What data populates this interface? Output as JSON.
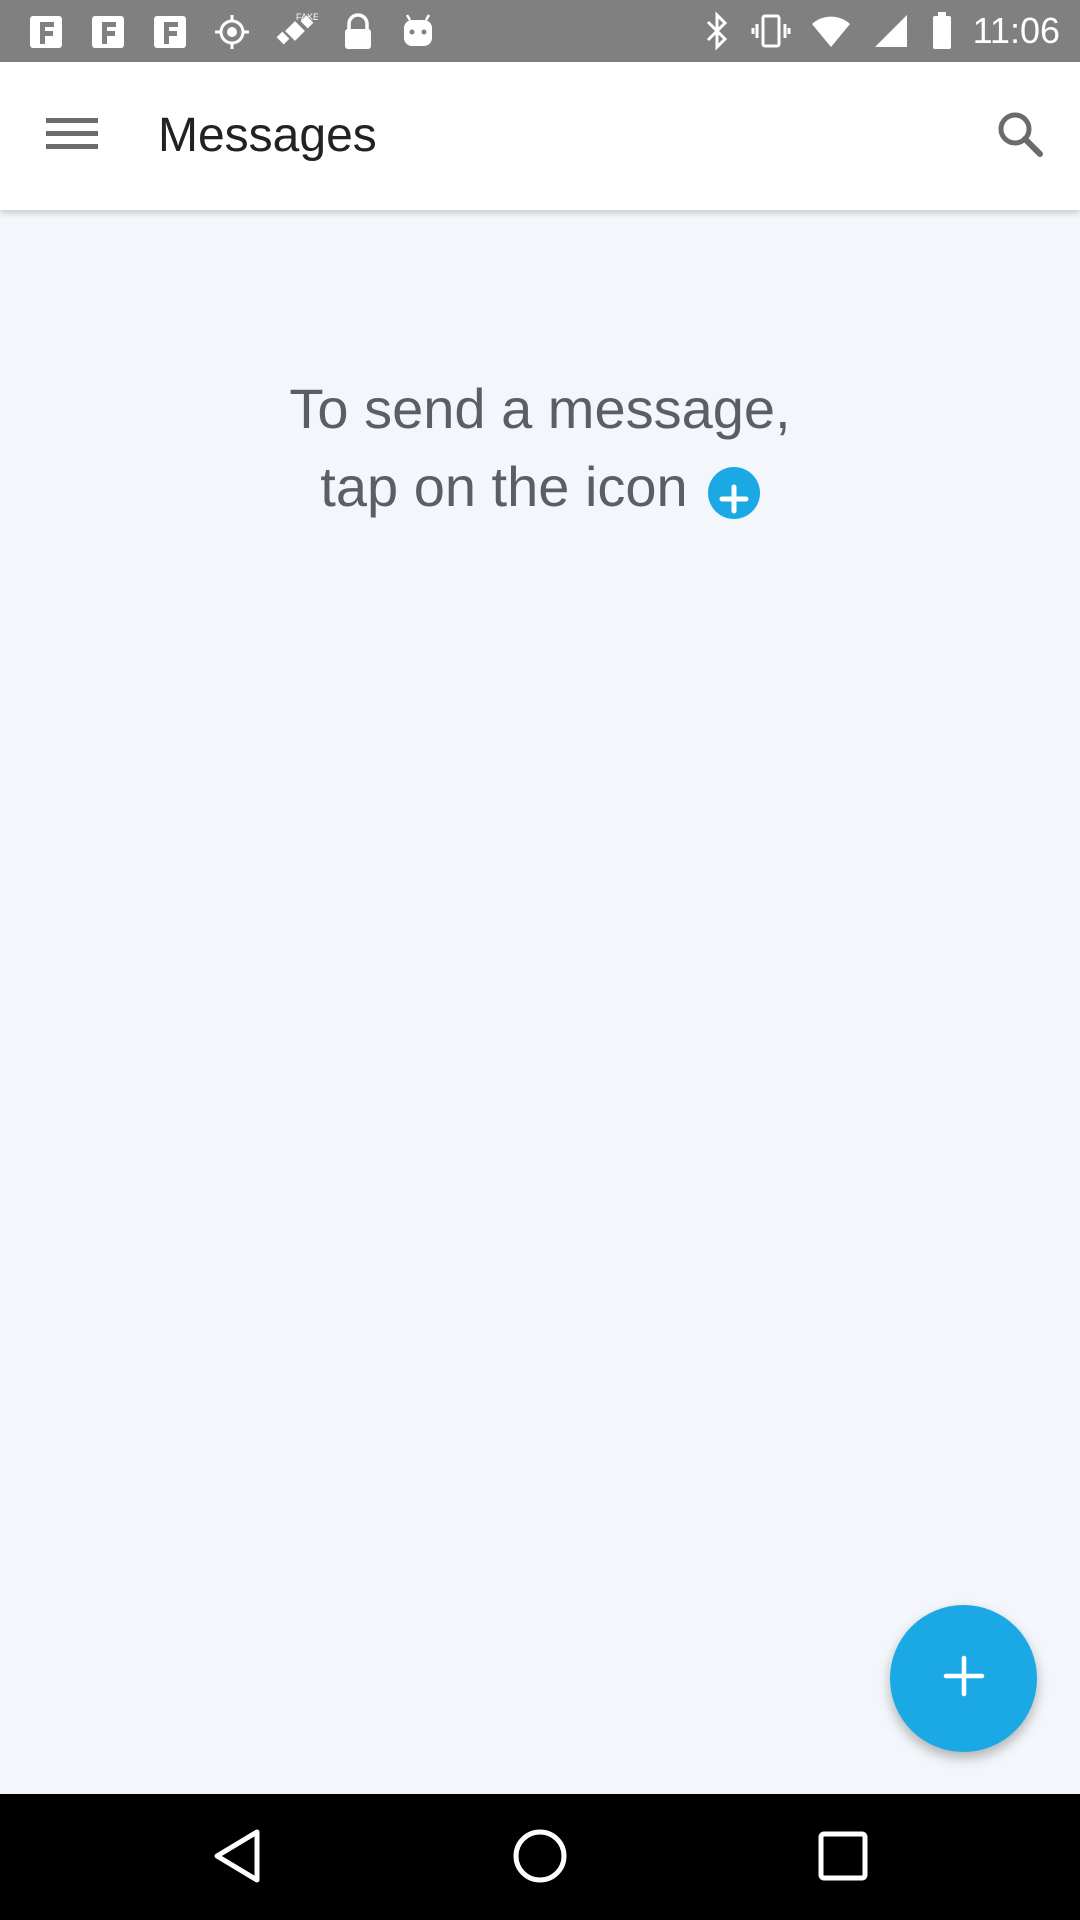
{
  "status_bar": {
    "time": "11:06",
    "left_icons": [
      "notification-icon",
      "notification-icon",
      "notification-icon",
      "gps-icon",
      "satellite-fake-icon",
      "lock-icon",
      "android-icon"
    ],
    "right_icons": [
      "bluetooth-icon",
      "vibrate-icon",
      "wifi-icon",
      "signal-icon",
      "battery-icon"
    ]
  },
  "app_bar": {
    "title": "Messages",
    "menu_icon": "hamburger-menu-icon",
    "search_icon": "search-icon"
  },
  "empty_state": {
    "line1": "To send a message,",
    "line2": "tap on the icon",
    "inline_icon": "plus-circle-icon"
  },
  "fab": {
    "icon": "plus-icon"
  },
  "nav_bar": {
    "back_icon": "back-triangle-icon",
    "home_icon": "home-circle-icon",
    "recents_icon": "recents-square-icon"
  },
  "colors": {
    "accent": "#1ba9e6",
    "background": "#f3f6fa",
    "status_bar": "#808080",
    "app_bar": "#ffffff",
    "title_text": "#222222",
    "hint_text": "#5a5f66",
    "nav_bar": "#000000"
  }
}
